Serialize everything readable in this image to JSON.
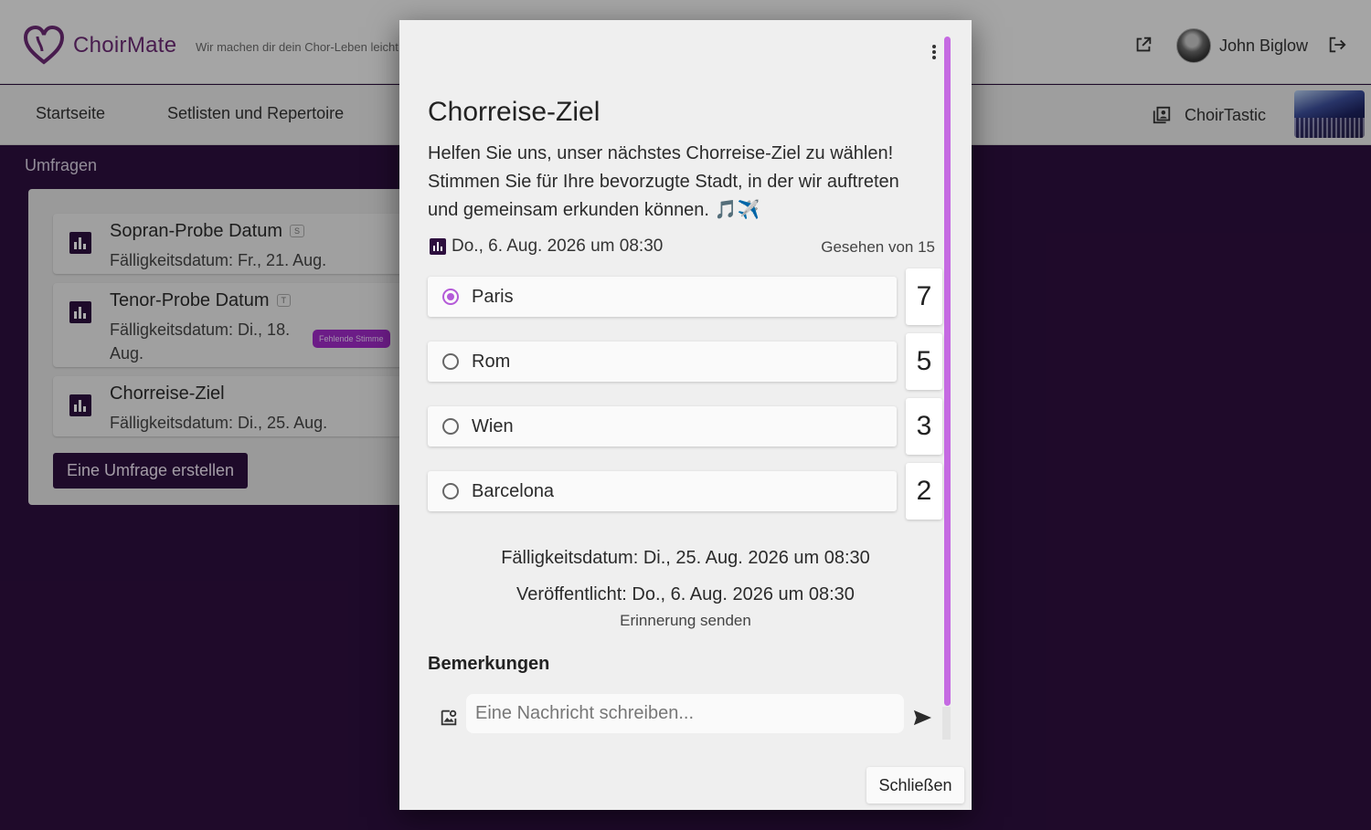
{
  "header": {
    "brand": "ChoirMate",
    "tagline": "Wir machen dir dein Chor-Leben leicht",
    "user_name": "John Biglow"
  },
  "nav": {
    "items": [
      "Startseite",
      "Setlisten und Repertoire"
    ],
    "choir_name": "ChoirTastic"
  },
  "surveys": {
    "section_title": "Umfragen",
    "items": [
      {
        "title": "Sopran-Probe Datum",
        "badge": "S",
        "due": "Fälligkeitsdatum: Fr., 21. Aug."
      },
      {
        "title": "Tenor-Probe Datum",
        "badge": "T",
        "due": "Fälligkeitsdatum: Di., 18. Aug.",
        "status": "Fehlende Stimme"
      },
      {
        "title": "Chorreise-Ziel",
        "due": "Fälligkeitsdatum: Di., 25. Aug."
      }
    ],
    "create_label": "Eine Umfrage erstellen"
  },
  "dialog": {
    "title": "Chorreise-Ziel",
    "description": "Helfen Sie uns, unser nächstes Chorreise-Ziel zu wählen! Stimmen Sie für Ihre bevorzugte Stadt, in der wir auftreten und gemeinsam erkunden können. 🎵✈️",
    "meta_date": "Do., 6. Aug. 2026 um 08:30",
    "seen": "Gesehen von 15",
    "options": [
      {
        "label": "Paris",
        "count": "7",
        "selected": true
      },
      {
        "label": "Rom",
        "count": "5",
        "selected": false
      },
      {
        "label": "Wien",
        "count": "3",
        "selected": false
      },
      {
        "label": "Barcelona",
        "count": "2",
        "selected": false
      }
    ],
    "due": "Fälligkeitsdatum: Di., 25. Aug. 2026 um 08:30",
    "published": "Veröffentlicht: Do., 6. Aug. 2026 um 08:30",
    "remind": "Erinnerung senden",
    "remarks_title": "Bemerkungen",
    "message_placeholder": "Eine Nachricht schreiben...",
    "close_label": "Schließen"
  },
  "colors": {
    "accent": "#b45ad8",
    "dark_purple": "#2d0f3e",
    "brand": "#6b2a74"
  },
  "icons": [
    "heart-logo-icon",
    "open-external-icon",
    "logout-icon",
    "choir-book-icon",
    "poll-icon",
    "more-vert-icon",
    "image-upload-icon",
    "send-icon"
  ]
}
